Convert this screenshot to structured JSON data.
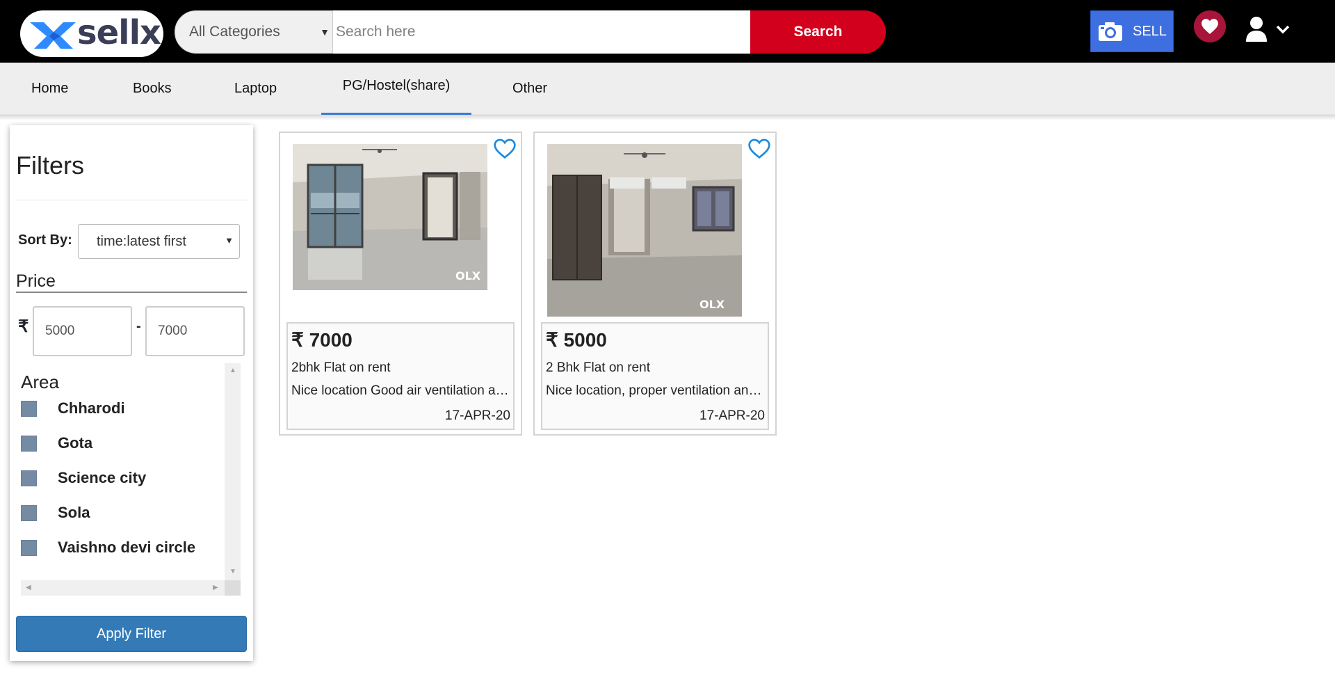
{
  "brand": {
    "name": "sellx",
    "primary": "#d2001c",
    "accent": "#3e6fe0",
    "logo_blue": "#2e8bff"
  },
  "header": {
    "category_select": "All Categories",
    "search_placeholder": "Search here",
    "search_button": "Search",
    "sell_button": "SELL",
    "icons": {
      "sell": "camera-icon",
      "favorites": "heart-icon",
      "account": "user-icon",
      "account_menu": "chevron-down-icon"
    }
  },
  "nav": {
    "items": [
      {
        "label": "Home"
      },
      {
        "label": "Books"
      },
      {
        "label": "Laptop"
      },
      {
        "label": "PG/Hostel(share)",
        "active": true
      },
      {
        "label": "Other"
      }
    ]
  },
  "filters": {
    "title": "Filters",
    "sort_label": "Sort By:",
    "sort_value": "time:latest first",
    "price_label": "Price",
    "currency": "₹",
    "price_min": "5000",
    "price_max": "7000",
    "price_separator": "-",
    "area_label": "Area",
    "areas": [
      {
        "label": "Chharodi"
      },
      {
        "label": "Gota"
      },
      {
        "label": "Science city"
      },
      {
        "label": "Sola"
      },
      {
        "label": "Vaishno devi circle"
      }
    ],
    "apply_button": "Apply Filter"
  },
  "listings": [
    {
      "price": "₹ 7000",
      "title": "2bhk Flat on rent",
      "description": "Nice location Good air ventilation and lots of sunlight",
      "date": "17-APR-20",
      "watermark": "OLX"
    },
    {
      "price": "₹ 5000",
      "title": "2 Bhk Flat on rent",
      "description": "Nice location, proper ventilation and natural light",
      "date": "17-APR-20",
      "watermark": "OLX"
    }
  ]
}
